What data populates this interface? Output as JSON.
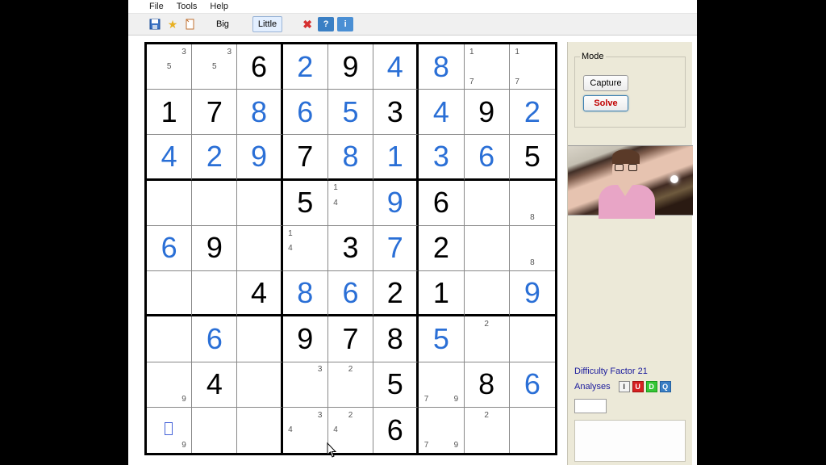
{
  "menu": {
    "file": "File",
    "tools": "Tools",
    "help": "Help"
  },
  "toolbar": {
    "save_icon": "save-icon",
    "star_icon": "star-icon",
    "doc_icon": "doc-icon",
    "big": "Big",
    "little": "Little",
    "delete_icon": "delete-x-icon",
    "help_q": "?",
    "info_i": "i"
  },
  "mode": {
    "title": "Mode",
    "capture": "Capture",
    "solve": "Solve"
  },
  "difficulty": {
    "label": "Difficulty Factor 21",
    "analyses": "Analyses",
    "btn_i": "I",
    "btn_u": "U",
    "btn_d": "D",
    "btn_q": "Q"
  },
  "grid": {
    "cells": [
      [
        {
          "c": [
            3,
            5
          ]
        },
        {
          "c": [
            3,
            5
          ]
        },
        {
          "v": 6,
          "t": "g"
        },
        {
          "v": 2,
          "t": "s"
        },
        {
          "v": 9,
          "t": "g"
        },
        {
          "v": 4,
          "t": "s"
        },
        {
          "v": 8,
          "t": "s"
        },
        {
          "c": [
            1,
            7
          ]
        },
        {
          "c": [
            1,
            7
          ]
        }
      ],
      [
        {
          "v": 1,
          "t": "g"
        },
        {
          "v": 7,
          "t": "g"
        },
        {
          "v": 8,
          "t": "s"
        },
        {
          "v": 6,
          "t": "s"
        },
        {
          "v": 5,
          "t": "s"
        },
        {
          "v": 3,
          "t": "g"
        },
        {
          "v": 4,
          "t": "s"
        },
        {
          "v": 9,
          "t": "g"
        },
        {
          "v": 2,
          "t": "s"
        }
      ],
      [
        {
          "v": 4,
          "t": "s"
        },
        {
          "v": 2,
          "t": "s"
        },
        {
          "v": 9,
          "t": "s"
        },
        {
          "v": 7,
          "t": "g"
        },
        {
          "v": 8,
          "t": "s"
        },
        {
          "v": 1,
          "t": "s"
        },
        {
          "v": 3,
          "t": "s"
        },
        {
          "v": 6,
          "t": "s"
        },
        {
          "v": 5,
          "t": "g"
        }
      ],
      [
        {},
        {},
        {},
        {
          "v": 5,
          "t": "g"
        },
        {
          "c": [
            1,
            4
          ]
        },
        {
          "v": 9,
          "t": "s"
        },
        {
          "v": 6,
          "t": "g"
        },
        {},
        {
          "c": [
            8
          ]
        }
      ],
      [
        {
          "v": 6,
          "t": "s"
        },
        {
          "v": 9,
          "t": "g"
        },
        {},
        {
          "c": [
            1,
            4
          ]
        },
        {
          "v": 3,
          "t": "g"
        },
        {
          "v": 7,
          "t": "s"
        },
        {
          "v": 2,
          "t": "g"
        },
        {},
        {
          "c": [
            8
          ]
        }
      ],
      [
        {},
        {},
        {
          "v": 4,
          "t": "g"
        },
        {
          "v": 8,
          "t": "s"
        },
        {
          "v": 6,
          "t": "s"
        },
        {
          "v": 2,
          "t": "g"
        },
        {
          "v": 1,
          "t": "g"
        },
        {},
        {
          "v": 9,
          "t": "s"
        }
      ],
      [
        {},
        {
          "v": 6,
          "t": "s"
        },
        {},
        {
          "v": 9,
          "t": "g"
        },
        {
          "v": 7,
          "t": "g"
        },
        {
          "v": 8,
          "t": "g"
        },
        {
          "v": 5,
          "t": "s"
        },
        {
          "c": [
            2
          ]
        },
        {}
      ],
      [
        {
          "c": [
            9
          ]
        },
        {
          "v": 4,
          "t": "g"
        },
        {},
        {
          "c": [
            3
          ]
        },
        {
          "c": [
            2
          ]
        },
        {
          "v": 5,
          "t": "g"
        },
        {
          "c": [
            7,
            9
          ]
        },
        {
          "v": 8,
          "t": "g"
        },
        {
          "v": 6,
          "t": "s"
        }
      ],
      [
        {
          "c": [
            9
          ],
          "cursor": true
        },
        {},
        {},
        {
          "c": [
            3,
            4
          ]
        },
        {
          "c": [
            2,
            4
          ]
        },
        {
          "v": 6,
          "t": "g"
        },
        {
          "c": [
            7,
            9
          ]
        },
        {
          "c": [
            2
          ]
        },
        {}
      ]
    ]
  }
}
